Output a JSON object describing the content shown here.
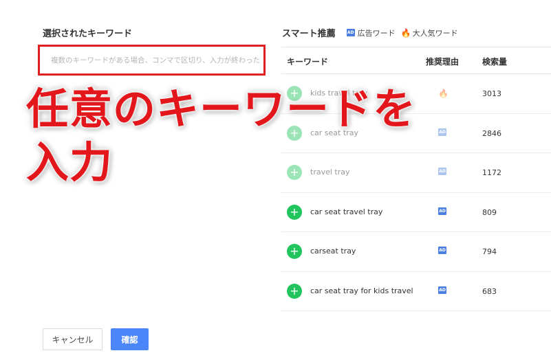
{
  "left": {
    "title": "選択されたキーワード",
    "input_placeholder": "複数のキーワードがある場合、コンマで区切り、入力が終わった",
    "input_value": ""
  },
  "smart": {
    "title": "スマート推薦",
    "legend_ad_badge": "AD",
    "legend_ad_label": "広告ワード",
    "legend_hot_label": "大人気ワード",
    "fire_icon": "🔥"
  },
  "table": {
    "headers": [
      "キーワード",
      "推奨理由",
      "検索量"
    ],
    "rows": [
      {
        "keyword": "kids travel tray",
        "reason": "hot",
        "volume": "3013",
        "faded": true
      },
      {
        "keyword": "car seat tray",
        "reason": "ad",
        "volume": "2846",
        "faded": true
      },
      {
        "keyword": "travel tray",
        "reason": "ad",
        "volume": "1172",
        "faded": true
      },
      {
        "keyword": "car seat travel tray",
        "reason": "ad",
        "volume": "809",
        "faded": false
      },
      {
        "keyword": "carseat tray",
        "reason": "ad",
        "volume": "794",
        "faded": false
      },
      {
        "keyword": "car seat tray for kids travel",
        "reason": "ad",
        "volume": "683",
        "faded": false
      }
    ],
    "add_symbol": "+"
  },
  "overlay": {
    "line1": "任意のキーワードを",
    "line2": "入力"
  },
  "buttons": {
    "cancel": "キャンセル",
    "confirm": "確認"
  },
  "colors": {
    "accent_blue": "#4a86f7",
    "add_green": "#21c45d",
    "overlay_red": "#e3161c",
    "input_border_red": "#e02020",
    "hot_pink": "#ff4d6a"
  }
}
